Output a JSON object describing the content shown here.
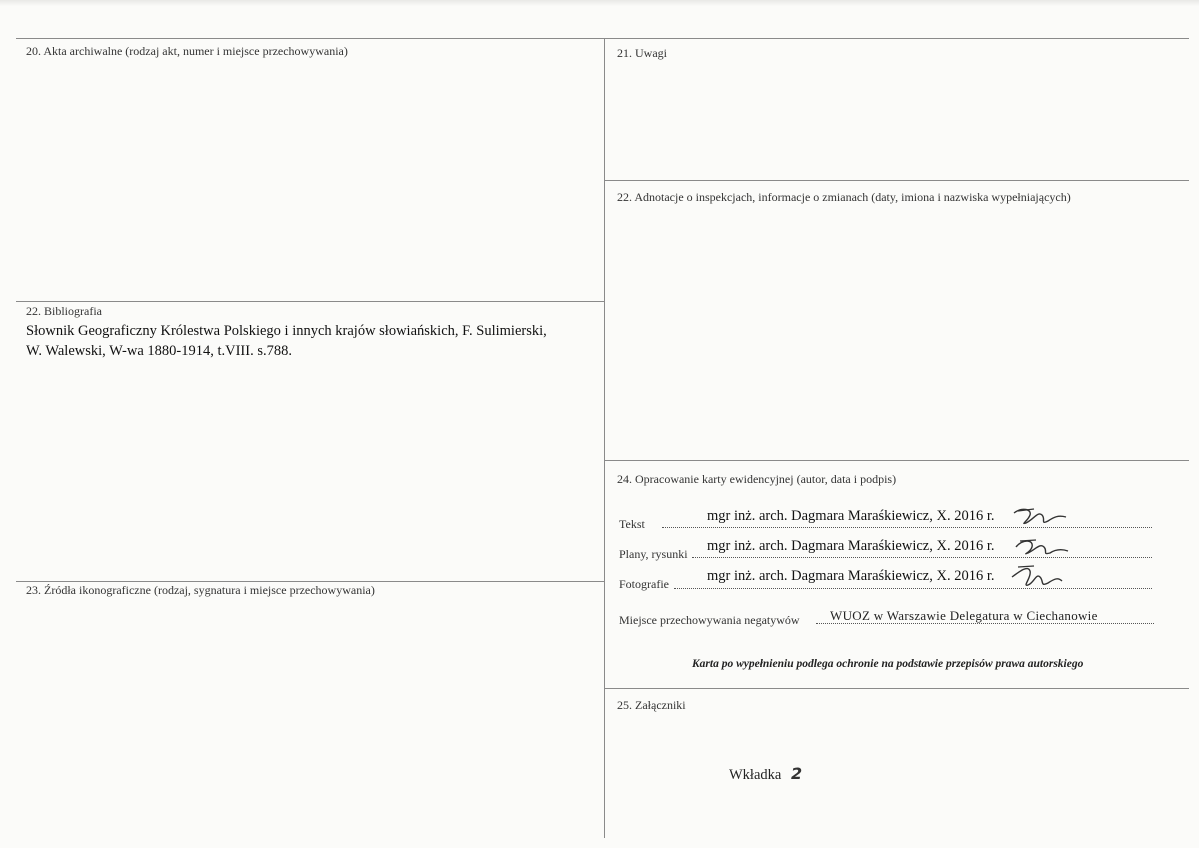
{
  "sections": {
    "s20": {
      "label": "20. Akta archiwalne (rodzaj akt, numer i miejsce przechowywania)"
    },
    "s21": {
      "label": "21. Uwagi"
    },
    "s22a": {
      "label": "22. Adnotacje o inspekcjach, informacje o zmianach (daty, imiona i nazwiska wypełniających)"
    },
    "s22b": {
      "label": "22. Bibliografia",
      "lines": [
        "Słownik Geograficzny Królestwa Polskiego i innych krajów słowiańskich, F. Sulimierski,",
        "W. Walewski, W-wa 1880-1914, t.VIII.  s.788."
      ]
    },
    "s23": {
      "label": "23. Źródła ikonograficzne (rodzaj, sygnatura i miejsce przechowywania)"
    },
    "s24": {
      "label": "24. Opracowanie karty ewidencyjnej (autor, data i podpis)",
      "rows": [
        {
          "label": "Tekst",
          "value": "mgr inż. arch. Dagmara Maraśkiewicz, X. 2016 r."
        },
        {
          "label": "Plany, rysunki",
          "value": "mgr inż. arch. Dagmara Maraśkiewicz, X. 2016 r."
        },
        {
          "label": "Fotografie",
          "value": "mgr inż. arch. Dagmara Maraśkiewicz, X. 2016 r."
        }
      ],
      "negatives_label": "Miejsce przechowywania negatywów",
      "negatives_value": "WUOZ w Warszawie Delegatura w Ciechanowie",
      "note": "Karta po wypełnieniu podlega ochronie na podstawie przepisów prawa autorskiego"
    },
    "s25": {
      "label": "25. Załączniki",
      "content": "Wkładka",
      "number": "2"
    }
  }
}
